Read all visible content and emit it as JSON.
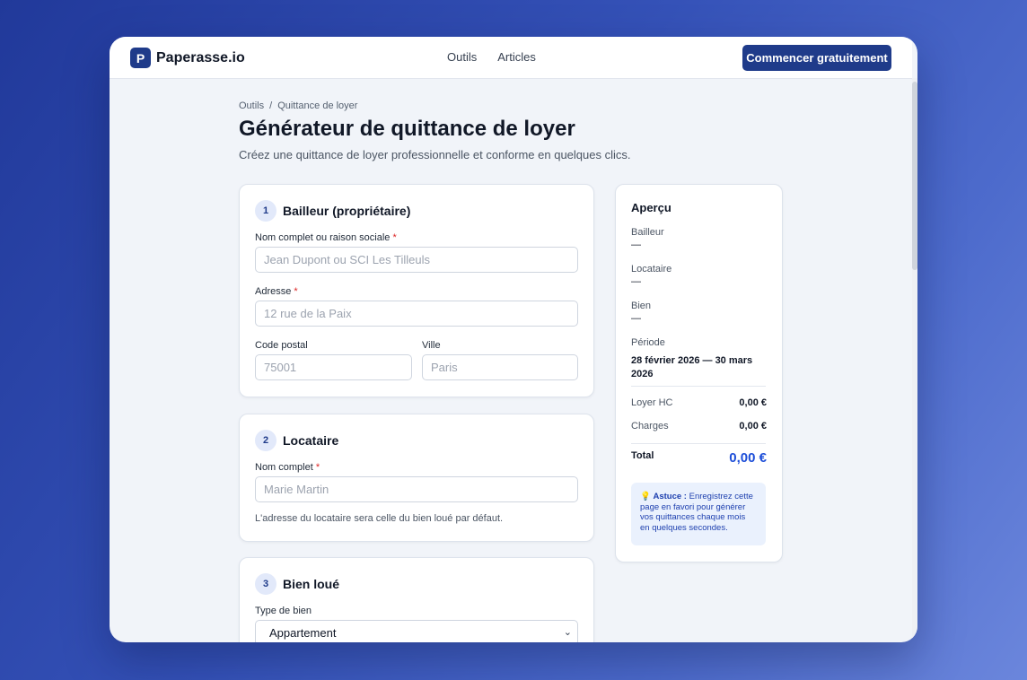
{
  "app": {
    "logo_letter": "P",
    "name": "Paperasse.io",
    "nav": [
      {
        "label": "Outils"
      },
      {
        "label": "Articles"
      }
    ],
    "cta_label": "Commencer gratuitement",
    "brand_color": "#1f3b8a",
    "accent_color": "#1d4ed8"
  },
  "breadcrumb": {
    "items": [
      {
        "label": "Outils"
      },
      {
        "label": "Quittance de loyer"
      }
    ],
    "separator": "/"
  },
  "page": {
    "title": "Générateur de quittance de loyer",
    "subtitle": "Créez une quittance de loyer professionnelle et conforme en quelques clics."
  },
  "sections": {
    "bailleur": {
      "step": "1",
      "title": "Bailleur (propriétaire)",
      "name_label": "Nom complet ou raison sociale",
      "name_placeholder": "Jean Dupont ou SCI Les Tilleuls",
      "address_label": "Adresse",
      "address_placeholder": "12 rue de la Paix",
      "zip_label": "Code postal",
      "zip_placeholder": "75001",
      "city_label": "Ville",
      "city_placeholder": "Paris"
    },
    "locataire": {
      "step": "2",
      "title": "Locataire",
      "name_label": "Nom complet",
      "name_placeholder": "Marie Martin",
      "hint": "L'adresse du locataire sera celle du bien loué par défaut."
    },
    "bien": {
      "step": "3",
      "title": "Bien loué",
      "type_label": "Type de bien",
      "type_value": "Appartement"
    }
  },
  "required_marker": "*",
  "preview": {
    "title": "Aperçu",
    "bailleur_label": "Bailleur",
    "bailleur_value": "—",
    "locataire_label": "Locataire",
    "locataire_value": "—",
    "bien_label": "Bien",
    "bien_value": "—",
    "periode_label": "Période",
    "periode_value": "28 février 2026 — 30 mars 2026",
    "loyer_label": "Loyer HC",
    "loyer_value": "0,00 €",
    "charges_label": "Charges",
    "charges_value": "0,00 €",
    "total_label": "Total",
    "total_value": "0,00 €",
    "tip_icon": "lightbulb-icon",
    "tip_bold": "Astuce :",
    "tip_text": "Enregistrez cette page en favori pour générer vos quittances chaque mois en quelques secondes."
  }
}
